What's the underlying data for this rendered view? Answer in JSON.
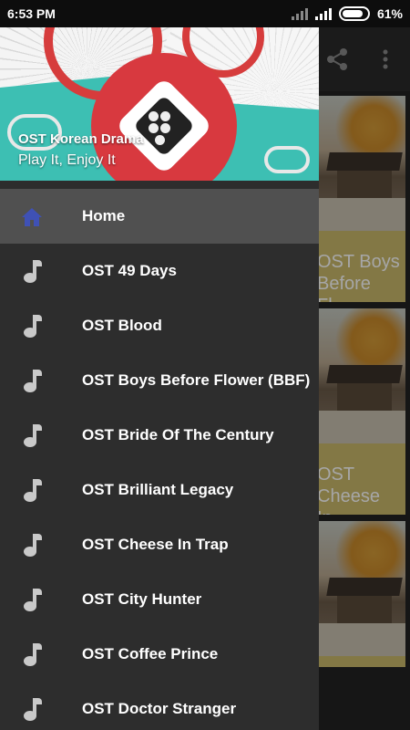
{
  "status_bar": {
    "time": "6:53 PM",
    "battery_percent": "61%"
  },
  "background_app": {
    "card_titles": [
      "OST Boys Before Fl...",
      "OST Cheese In..."
    ]
  },
  "drawer": {
    "header": {
      "title": "OST Korean Drama",
      "subtitle": "Play It, Enjoy It"
    },
    "items": [
      {
        "label": "Home",
        "icon": "home-icon",
        "active": true
      },
      {
        "label": "OST 49 Days",
        "icon": "music-note-icon"
      },
      {
        "label": "OST Blood",
        "icon": "music-note-icon"
      },
      {
        "label": "OST Boys Before Flower (BBF)",
        "icon": "music-note-icon"
      },
      {
        "label": "OST Bride Of The Century",
        "icon": "music-note-icon"
      },
      {
        "label": "OST Brilliant Legacy",
        "icon": "music-note-icon"
      },
      {
        "label": "OST Cheese In Trap",
        "icon": "music-note-icon"
      },
      {
        "label": "OST City Hunter",
        "icon": "music-note-icon"
      },
      {
        "label": "OST Coffee Prince",
        "icon": "music-note-icon"
      },
      {
        "label": "OST Doctor Stranger",
        "icon": "music-note-icon"
      }
    ]
  },
  "colors": {
    "accent_home": "#3f51b5",
    "drawer_bg": "#2d2d2d",
    "active_row": "#505050",
    "header_teal": "#3dbfb3"
  }
}
